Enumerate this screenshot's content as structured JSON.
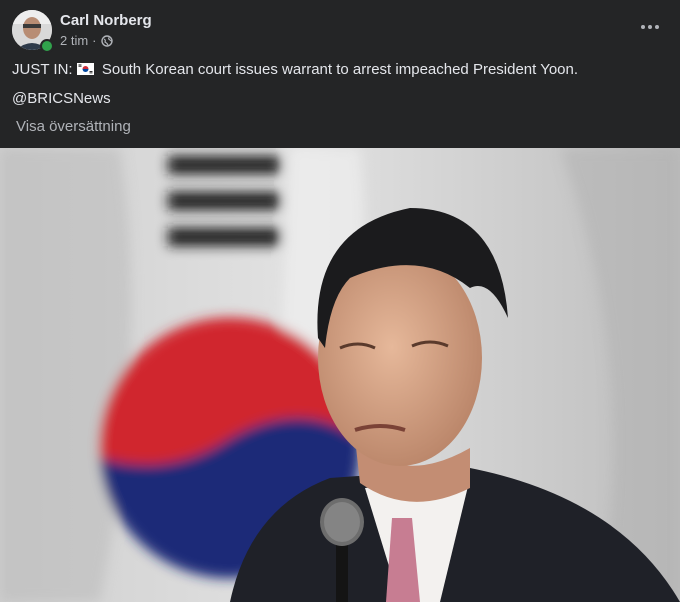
{
  "post": {
    "author": "Carl Norberg",
    "time": "2 tim",
    "separator": "·",
    "privacy_icon": "globe-icon",
    "more_icon": "more-horizontal-icon",
    "text_prefix": "JUST IN:",
    "flag_icon": "south-korea-flag-icon",
    "text_body": "South Korean court issues warrant to arrest impeached President Yoon.",
    "mention": "@BRICSNews",
    "translate_label": "Visa översättning"
  },
  "colors": {
    "background": "#242526",
    "text_primary": "#e4e6eb",
    "text_secondary": "#b0b3b8",
    "online_status": "#31a24c"
  }
}
